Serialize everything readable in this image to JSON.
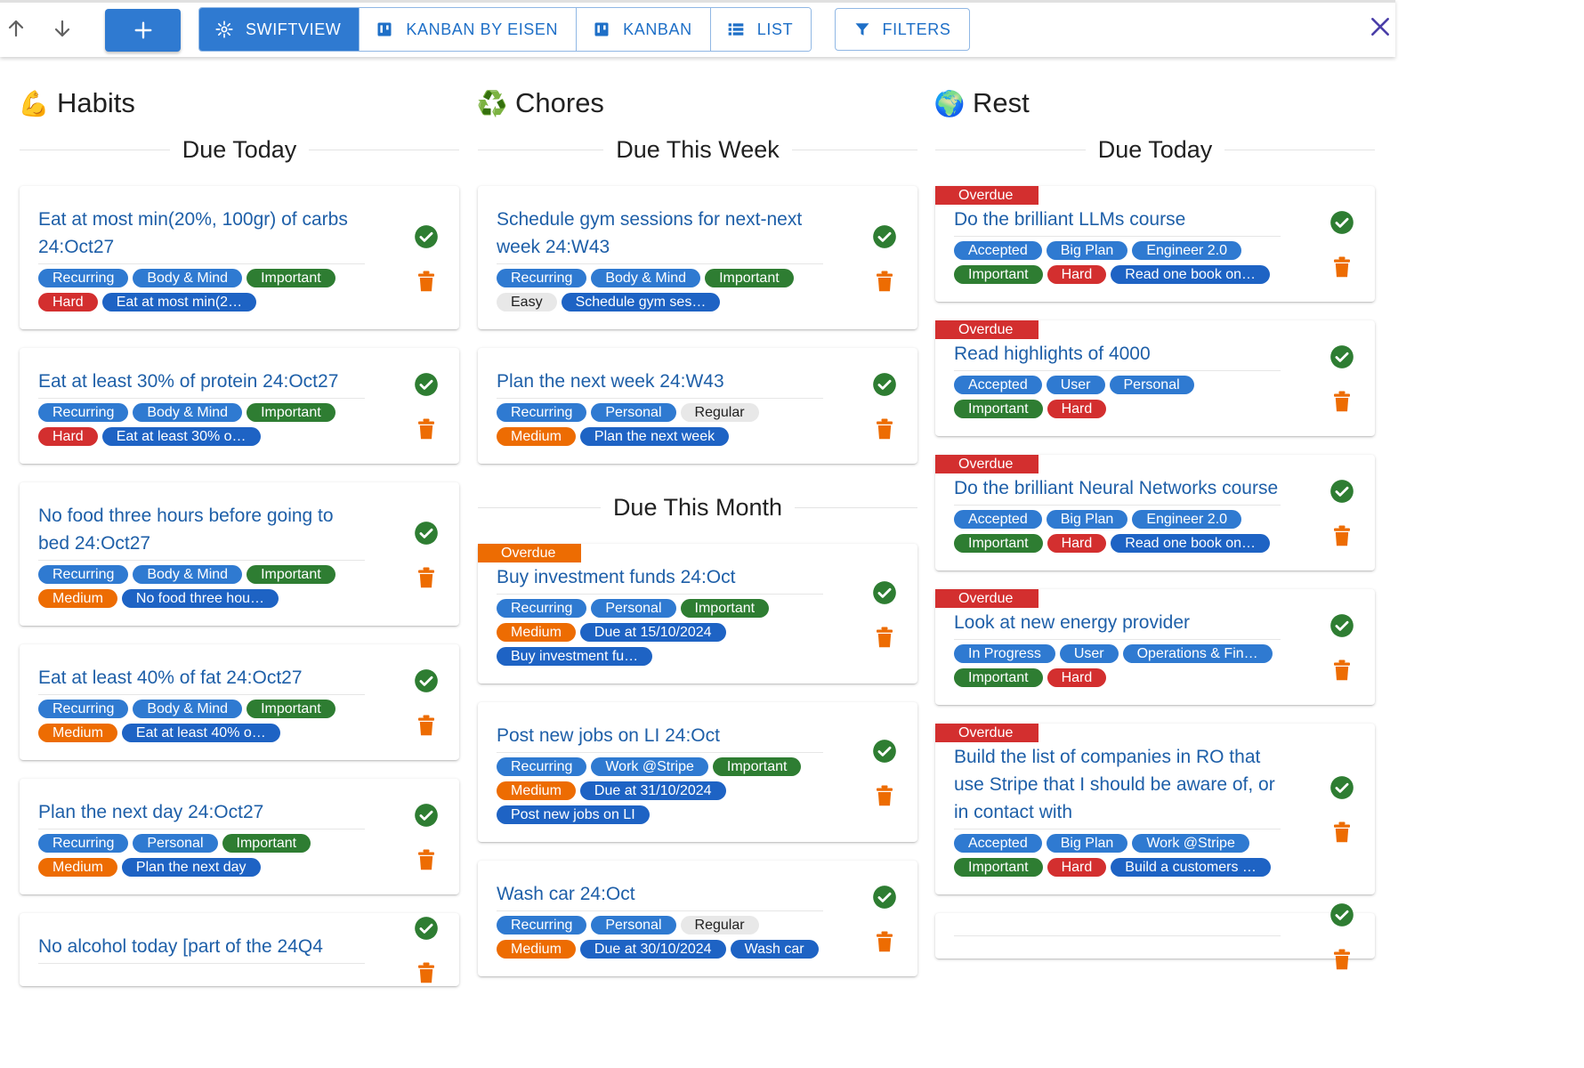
{
  "colors": {
    "accent": "#2f7ad1",
    "link": "#1e5fa8",
    "green": "#2e7d32",
    "red": "#d32f2f",
    "orange": "#ed6c02",
    "grey": "#e8e8e8"
  },
  "toolbar": {
    "up_icon": "arrow-up-icon",
    "down_icon": "arrow-down-icon",
    "add_icon": "plus-icon",
    "views": [
      {
        "label": "SWIFTVIEW",
        "icon": "sparkle-icon",
        "active": true
      },
      {
        "label": "KANBAN BY EISEN",
        "icon": "kanban-icon",
        "active": false
      },
      {
        "label": "KANBAN",
        "icon": "kanban-icon",
        "active": false
      },
      {
        "label": "LIST",
        "icon": "list-icon",
        "active": false
      }
    ],
    "filters_label": "FILTERS",
    "close_icon": "close-icon"
  },
  "columns": [
    {
      "title": "Habits",
      "emoji": "💪",
      "sections": [
        {
          "heading": "Due Today",
          "cards": [
            {
              "title": "Eat at most min(20%, 100gr) of carbs 24:Oct27",
              "tags": [
                {
                  "label": "Recurring",
                  "color": "blue"
                },
                {
                  "label": "Body & Mind",
                  "color": "blue"
                },
                {
                  "label": "Important",
                  "color": "green"
                },
                {
                  "label": "Hard",
                  "color": "red"
                },
                {
                  "label": "Eat at most min(2…",
                  "color": "navy"
                }
              ]
            },
            {
              "title": "Eat at least 30% of protein 24:Oct27",
              "tags": [
                {
                  "label": "Recurring",
                  "color": "blue"
                },
                {
                  "label": "Body & Mind",
                  "color": "blue"
                },
                {
                  "label": "Important",
                  "color": "green"
                },
                {
                  "label": "Hard",
                  "color": "red"
                },
                {
                  "label": "Eat at least 30% o…",
                  "color": "navy"
                }
              ]
            },
            {
              "title": "No food three hours before going to bed 24:Oct27",
              "tags": [
                {
                  "label": "Recurring",
                  "color": "blue"
                },
                {
                  "label": "Body & Mind",
                  "color": "blue"
                },
                {
                  "label": "Important",
                  "color": "green"
                },
                {
                  "label": "Medium",
                  "color": "orange"
                },
                {
                  "label": "No food three hou…",
                  "color": "navy"
                }
              ]
            },
            {
              "title": "Eat at least 40% of fat 24:Oct27",
              "tags": [
                {
                  "label": "Recurring",
                  "color": "blue"
                },
                {
                  "label": "Body & Mind",
                  "color": "blue"
                },
                {
                  "label": "Important",
                  "color": "green"
                },
                {
                  "label": "Medium",
                  "color": "orange"
                },
                {
                  "label": "Eat at least 40% o…",
                  "color": "navy"
                }
              ]
            },
            {
              "title": "Plan the next day 24:Oct27",
              "tags": [
                {
                  "label": "Recurring",
                  "color": "blue"
                },
                {
                  "label": "Personal",
                  "color": "blue"
                },
                {
                  "label": "Important",
                  "color": "green"
                },
                {
                  "label": "Medium",
                  "color": "orange"
                },
                {
                  "label": "Plan the next day",
                  "color": "navy"
                }
              ]
            },
            {
              "title": "No alcohol today [part of the 24Q4",
              "tags": []
            }
          ]
        }
      ]
    },
    {
      "title": "Chores",
      "emoji": "♻️",
      "sections": [
        {
          "heading": "Due This Week",
          "cards": [
            {
              "title": "Schedule gym sessions for next-next week 24:W43",
              "tags": [
                {
                  "label": "Recurring",
                  "color": "blue"
                },
                {
                  "label": "Body & Mind",
                  "color": "blue"
                },
                {
                  "label": "Important",
                  "color": "green"
                },
                {
                  "label": "Easy",
                  "color": "grey"
                },
                {
                  "label": "Schedule gym ses…",
                  "color": "navy"
                }
              ]
            },
            {
              "title": "Plan the next week 24:W43",
              "tags": [
                {
                  "label": "Recurring",
                  "color": "blue"
                },
                {
                  "label": "Personal",
                  "color": "blue"
                },
                {
                  "label": "Regular",
                  "color": "grey"
                },
                {
                  "label": "Medium",
                  "color": "orange"
                },
                {
                  "label": "Plan the next week",
                  "color": "navy"
                }
              ]
            }
          ]
        },
        {
          "heading": "Due This Month",
          "cards": [
            {
              "overdue": "Overdue",
              "overdue_color": "orange",
              "title": "Buy investment funds 24:Oct",
              "tags": [
                {
                  "label": "Recurring",
                  "color": "blue"
                },
                {
                  "label": "Personal",
                  "color": "blue"
                },
                {
                  "label": "Important",
                  "color": "green"
                },
                {
                  "label": "Medium",
                  "color": "orange"
                },
                {
                  "label": "Due at 15/10/2024",
                  "color": "navy"
                },
                {
                  "label": "Buy investment fu…",
                  "color": "navy"
                }
              ]
            },
            {
              "title": "Post new jobs on LI 24:Oct",
              "tags": [
                {
                  "label": "Recurring",
                  "color": "blue"
                },
                {
                  "label": "Work @Stripe",
                  "color": "blue"
                },
                {
                  "label": "Important",
                  "color": "green"
                },
                {
                  "label": "Medium",
                  "color": "orange"
                },
                {
                  "label": "Due at 31/10/2024",
                  "color": "navy"
                },
                {
                  "label": "Post new jobs on LI",
                  "color": "navy"
                }
              ]
            },
            {
              "title": "Wash car 24:Oct",
              "tags": [
                {
                  "label": "Recurring",
                  "color": "blue"
                },
                {
                  "label": "Personal",
                  "color": "blue"
                },
                {
                  "label": "Regular",
                  "color": "grey"
                },
                {
                  "label": "Medium",
                  "color": "orange"
                },
                {
                  "label": "Due at 30/10/2024",
                  "color": "navy"
                },
                {
                  "label": "Wash car",
                  "color": "navy"
                }
              ]
            }
          ]
        }
      ]
    },
    {
      "title": "Rest",
      "emoji": "🌍",
      "sections": [
        {
          "heading": "Due Today",
          "cards": [
            {
              "overdue": "Overdue",
              "title": "Do the brilliant LLMs course",
              "tags": [
                {
                  "label": "Accepted",
                  "color": "blue"
                },
                {
                  "label": "Big Plan",
                  "color": "blue"
                },
                {
                  "label": "Engineer 2.0",
                  "color": "blue"
                },
                {
                  "label": "Important",
                  "color": "green"
                },
                {
                  "label": "Hard",
                  "color": "red"
                },
                {
                  "label": "Read one book on…",
                  "color": "navy"
                }
              ]
            },
            {
              "overdue": "Overdue",
              "title": "Read highlights of 4000",
              "tags": [
                {
                  "label": "Accepted",
                  "color": "blue"
                },
                {
                  "label": "User",
                  "color": "blue"
                },
                {
                  "label": "Personal",
                  "color": "blue"
                },
                {
                  "label": "Important",
                  "color": "green"
                },
                {
                  "label": "Hard",
                  "color": "red"
                }
              ]
            },
            {
              "overdue": "Overdue",
              "title": "Do the brilliant Neural Networks course",
              "tags": [
                {
                  "label": "Accepted",
                  "color": "blue"
                },
                {
                  "label": "Big Plan",
                  "color": "blue"
                },
                {
                  "label": "Engineer 2.0",
                  "color": "blue"
                },
                {
                  "label": "Important",
                  "color": "green"
                },
                {
                  "label": "Hard",
                  "color": "red"
                },
                {
                  "label": "Read one book on…",
                  "color": "navy"
                }
              ]
            },
            {
              "overdue": "Overdue",
              "title": "Look at new energy provider",
              "tags": [
                {
                  "label": "In Progress",
                  "color": "blue"
                },
                {
                  "label": "User",
                  "color": "blue"
                },
                {
                  "label": "Operations & Fin…",
                  "color": "blue"
                },
                {
                  "label": "Important",
                  "color": "green"
                },
                {
                  "label": "Hard",
                  "color": "red"
                }
              ]
            },
            {
              "overdue": "Overdue",
              "title": "Build the list of companies in RO that use Stripe that I should be aware of, or in contact with",
              "tags": [
                {
                  "label": "Accepted",
                  "color": "blue"
                },
                {
                  "label": "Big Plan",
                  "color": "blue"
                },
                {
                  "label": "Work @Stripe",
                  "color": "blue"
                },
                {
                  "label": "Important",
                  "color": "green"
                },
                {
                  "label": "Hard",
                  "color": "red"
                },
                {
                  "label": "Build a customers …",
                  "color": "navy"
                }
              ]
            },
            {
              "overdue": "",
              "title": "",
              "tags": []
            }
          ]
        }
      ]
    }
  ]
}
